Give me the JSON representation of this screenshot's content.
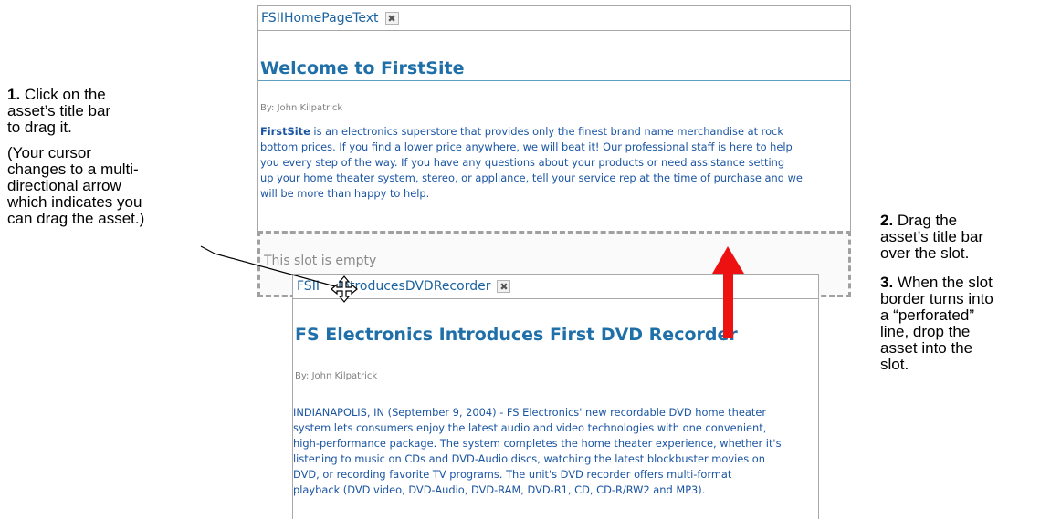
{
  "left_callout": {
    "step_num": "1.",
    "line1": "Click on the",
    "line2": "asset’s title bar",
    "line3": "to drag it.",
    "note_lines": [
      "(Your cursor",
      "changes to a multi-",
      "directional arrow",
      "which indicates you",
      "can drag the asset.)"
    ]
  },
  "right_callout": {
    "step2_num": "2.",
    "step2_line1": "Drag the",
    "step2_line2": "asset’s title bar",
    "step2_line3": "over the slot.",
    "step3_num": "3.",
    "step3_line1": "When the slot",
    "step3_line2": "border turns into",
    "step3_line3": "a “perforated”",
    "step3_line4": "line, drop the",
    "step3_line5": "asset into the",
    "step3_line6": "slot."
  },
  "top_asset": {
    "title": "FSIIHomePageText",
    "close_glyph": "✖",
    "heading": "Welcome to FirstSite",
    "byline": "By: John Kilpatrick",
    "body_lead": "FirstSite",
    "body_lines": [
      " is an electronics superstore that provides only the finest brand name merchandise at rock",
      "bottom prices. If you find a lower price anywhere, we will beat it! Our professional staff is here to help",
      "you every step of the way. If you have any questions about your products or need assistance setting",
      "up your home theater system, stereo, or appliance, tell your service rep at the time of purchase and we",
      "will be more than happy to help."
    ]
  },
  "slot": {
    "text": "This slot is empty"
  },
  "dragged_asset": {
    "title_visible_a": "FSII",
    "title_visible_b": "IntroducesDVDRecorder",
    "close_glyph": "✖",
    "heading": "FS Electronics Introduces First DVD Recorder",
    "byline": "By:  John Kilpatrick",
    "body_lines": [
      "INDIANAPOLIS, IN (September 9, 2004) - FS Electronics' new recordable DVD home theater",
      "system lets consumers enjoy the latest audio and video technologies with one convenient,",
      "high-performance package. The system completes the home theater experience, whether it's",
      "listening to music on CDs and DVD-Audio discs, watching the latest blockbuster movies on",
      "DVD, or recording favorite TV programs. The unit's DVD recorder offers multi-format",
      "playback (DVD video, DVD-Audio, DVD-RAM, DVD-R1, CD, CD-R/RW2 and MP3)."
    ]
  },
  "icons": {
    "cursor": "move-cursor-icon",
    "arrow": "drag-direction-arrow-icon",
    "arrow_color": "#ee1111"
  }
}
